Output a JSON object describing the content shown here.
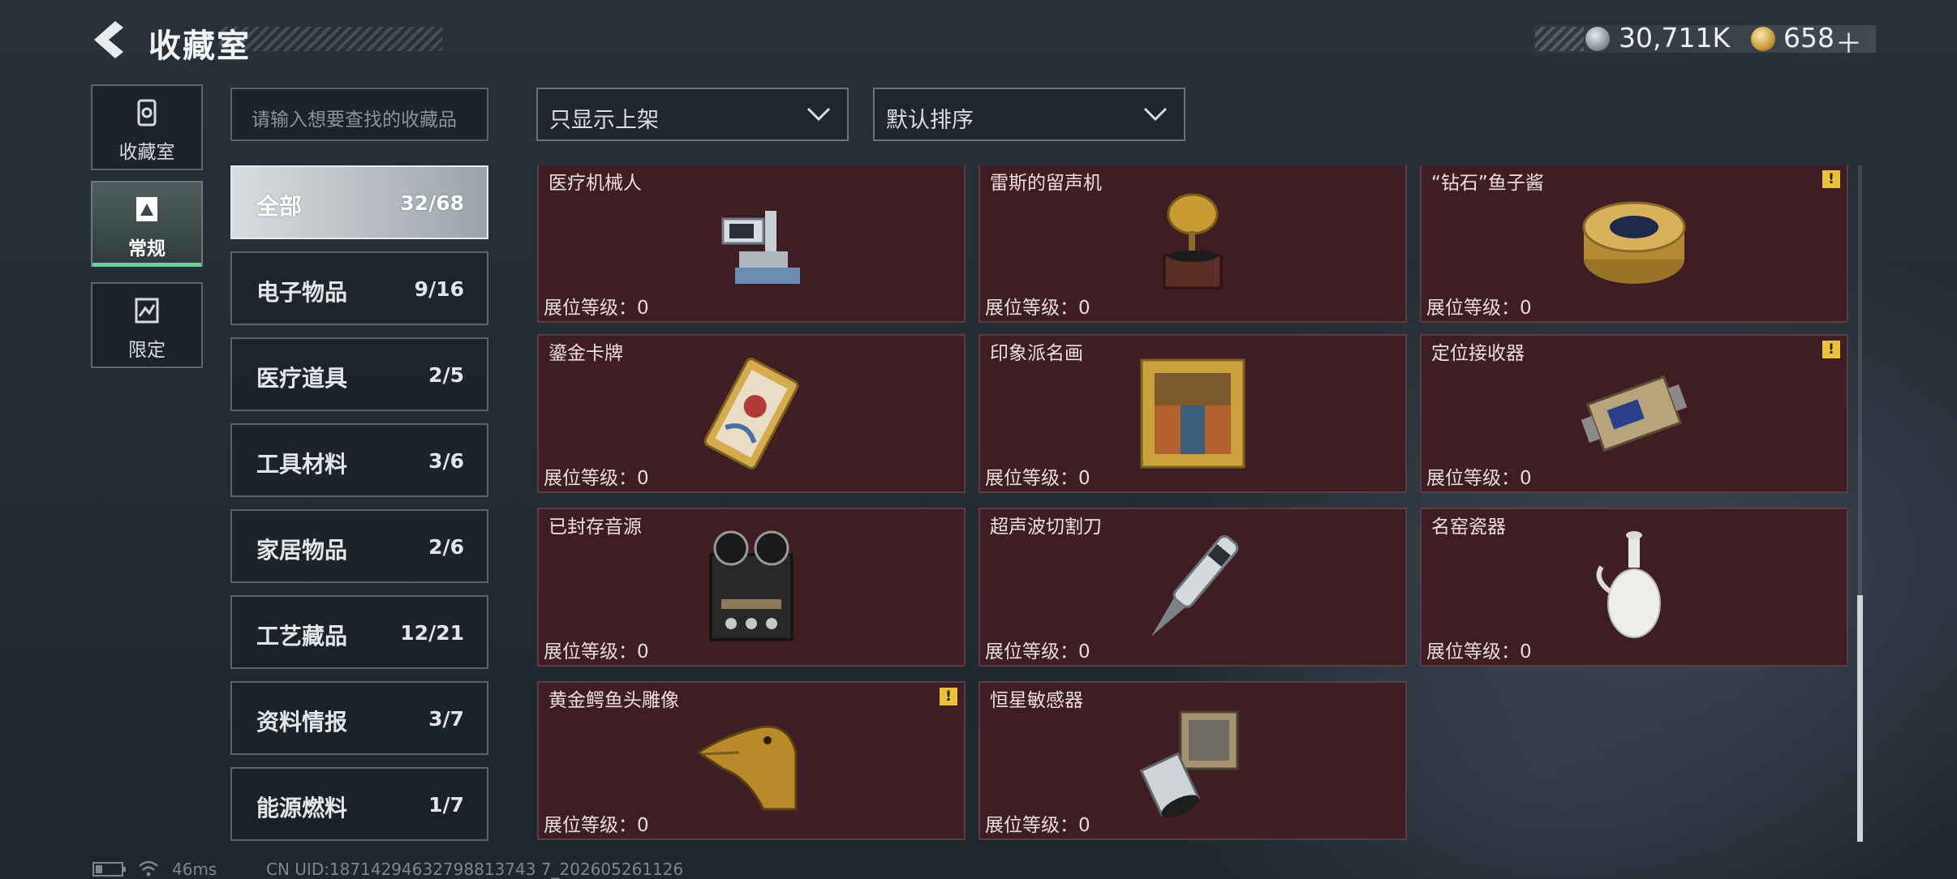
{
  "header": {
    "title": "收藏室",
    "currency1": "30,711K",
    "currency2": "658",
    "add": "＋"
  },
  "nav": [
    {
      "label": "收藏室",
      "icon": "collection-room-icon"
    },
    {
      "label": "常规",
      "icon": "regular-icon",
      "active": true
    },
    {
      "label": "限定",
      "icon": "limited-icon"
    }
  ],
  "search": {
    "placeholder": "请输入想要查找的收藏品"
  },
  "filters": {
    "shelf": "只显示上架",
    "sort": "默认排序"
  },
  "categories": [
    {
      "name": "全部",
      "count": "32/68"
    },
    {
      "name": "电子物品",
      "count": "9/16"
    },
    {
      "name": "医疗道具",
      "count": "2/5"
    },
    {
      "name": "工具材料",
      "count": "3/6"
    },
    {
      "name": "家居物品",
      "count": "2/6"
    },
    {
      "name": "工艺藏品",
      "count": "12/21"
    },
    {
      "name": "资料情报",
      "count": "3/7"
    },
    {
      "name": "能源燃料",
      "count": "1/7"
    }
  ],
  "items": [
    {
      "name": "医疗机械人",
      "level": "展位等级：0",
      "icon": "medical-robot-icon"
    },
    {
      "name": "雷斯的留声机",
      "level": "展位等级：0",
      "icon": "gramophone-icon"
    },
    {
      "name": "“钻石”鱼子酱",
      "level": "展位等级：0",
      "icon": "caviar-tin-icon",
      "warn": "!"
    },
    {
      "name": "鎏金卡牌",
      "level": "展位等级：0",
      "icon": "gilded-card-icon"
    },
    {
      "name": "印象派名画",
      "level": "展位等级：0",
      "icon": "framed-painting-icon"
    },
    {
      "name": "定位接收器",
      "level": "展位等级：0",
      "icon": "locator-receiver-icon",
      "warn": "!"
    },
    {
      "name": "已封存音源",
      "level": "展位等级：0",
      "icon": "reel-tape-recorder-icon"
    },
    {
      "name": "超声波切割刀",
      "level": "展位等级：0",
      "icon": "ultrasonic-cutter-icon"
    },
    {
      "name": "名窑瓷器",
      "level": "展位等级：0",
      "icon": "porcelain-vase-icon"
    },
    {
      "name": "黄金鳄鱼头雕像",
      "level": "展位等级：0",
      "icon": "golden-crocodile-head-icon",
      "warn": "!"
    },
    {
      "name": "恒星敏感器",
      "level": "展位等级：0",
      "icon": "star-sensor-icon"
    }
  ],
  "footer": {
    "ping": "46ms",
    "uid": "CN UID:18714294632798813743 7_202605261126"
  }
}
